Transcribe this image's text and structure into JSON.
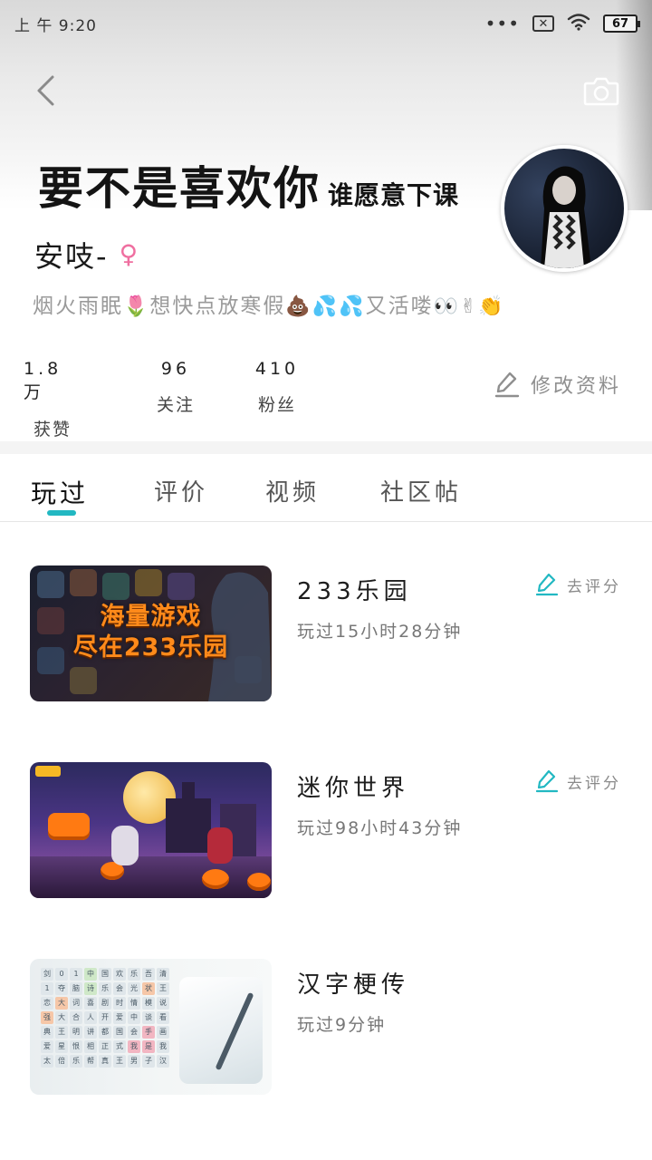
{
  "status_bar": {
    "time": "上 午 9:20",
    "more": "•••",
    "sim": "✕",
    "battery": "67"
  },
  "header": {
    "banner_text_big": "要不是喜欢你",
    "banner_text_small": "谁愿意下课"
  },
  "profile": {
    "nickname": "安吱-",
    "gender_symbol": "♀",
    "bio_text_1": "烟火雨眠",
    "bio_emoji_1": "🌷",
    "bio_text_2": "想快点放寒假",
    "bio_emoji_2": "💩💦💦",
    "bio_text_3": "又活喽",
    "bio_emoji_3": "👀✌👏",
    "stats": [
      {
        "value": "1.8万",
        "label": "获赞"
      },
      {
        "value": "96",
        "label": "关注"
      },
      {
        "value": "410",
        "label": "粉丝"
      }
    ],
    "edit_label": "修改资料"
  },
  "tabs": [
    {
      "label": "玩过",
      "active": true
    },
    {
      "label": "评价",
      "active": false
    },
    {
      "label": "视频",
      "active": false
    },
    {
      "label": "社区帖",
      "active": false
    }
  ],
  "games": [
    {
      "title": "233乐园",
      "played": "玩过15小时28分钟",
      "rate_label": "去评分",
      "promo_line1": "海量游戏",
      "promo_line2": "尽在233乐园"
    },
    {
      "title": "迷你世界",
      "played": "玩过98小时43分钟",
      "rate_label": "去评分"
    },
    {
      "title": "汉字梗传",
      "played": "玩过9分钟"
    }
  ],
  "hanzi_grid": [
    "剑",
    "0",
    "1",
    "中",
    "国",
    "欢",
    "乐",
    "吾",
    "清",
    "1",
    "夺",
    "脑",
    "诗",
    "乐",
    "会",
    "光",
    "状",
    "王",
    "恋",
    "大",
    "词",
    "喜",
    "剧",
    "时",
    "情",
    "模",
    "说",
    "强",
    "大",
    "合",
    "人",
    "开",
    "爱",
    "中",
    "谈",
    "看",
    "典",
    "王",
    "明",
    "讲",
    "都",
    "国",
    "会",
    "手",
    "画",
    "爱",
    "星",
    "恨",
    "相",
    "正",
    "式",
    "我",
    "是",
    "我",
    "太",
    "倍",
    "乐",
    "帮",
    "真",
    "王",
    "男",
    "子",
    "汉",
    "保"
  ],
  "colors": {
    "accent": "#22b8c2",
    "gender": "#ef6fa0",
    "promo": "#ff8a1a"
  }
}
